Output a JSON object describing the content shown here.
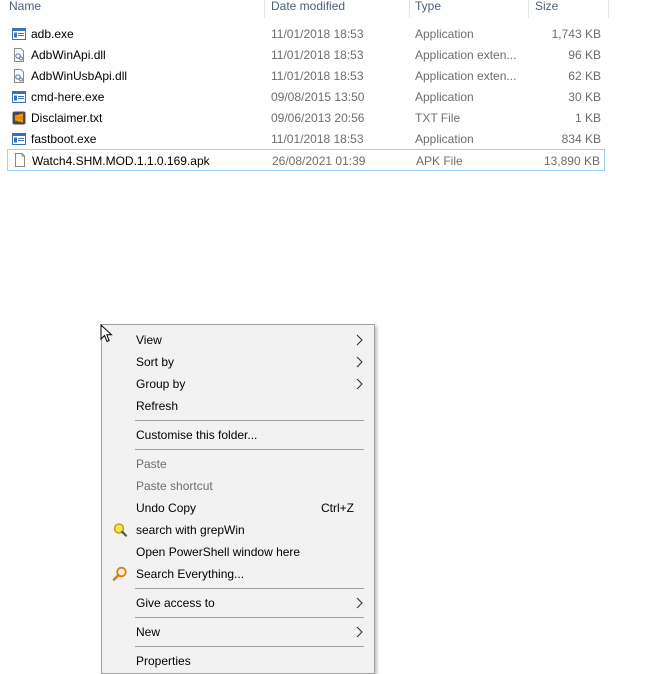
{
  "columns": {
    "name": "Name",
    "date": "Date modified",
    "type": "Type",
    "size": "Size"
  },
  "files": [
    {
      "name": "adb.exe",
      "date": "11/01/2018 18:53",
      "type": "Application",
      "size": "1,743 KB",
      "icon": "exe-icon"
    },
    {
      "name": "AdbWinApi.dll",
      "date": "11/01/2018 18:53",
      "type": "Application exten...",
      "size": "96 KB",
      "icon": "dll-icon"
    },
    {
      "name": "AdbWinUsbApi.dll",
      "date": "11/01/2018 18:53",
      "type": "Application exten...",
      "size": "62 KB",
      "icon": "dll-icon"
    },
    {
      "name": "cmd-here.exe",
      "date": "09/08/2015 13:50",
      "type": "Application",
      "size": "30 KB",
      "icon": "exe-icon"
    },
    {
      "name": "Disclaimer.txt",
      "date": "09/06/2013 20:56",
      "type": "TXT File",
      "size": "1 KB",
      "icon": "sublime-text-icon"
    },
    {
      "name": "fastboot.exe",
      "date": "11/01/2018 18:53",
      "type": "Application",
      "size": "834 KB",
      "icon": "exe-icon"
    },
    {
      "name": "Watch4.SHM.MOD.1.1.0.169.apk",
      "date": "26/08/2021 01:39",
      "type": "APK File",
      "size": "13,890 KB",
      "icon": "blank-file-icon"
    }
  ],
  "context_menu": {
    "view": "View",
    "sort_by": "Sort by",
    "group_by": "Group by",
    "refresh": "Refresh",
    "customise": "Customise this folder...",
    "paste": "Paste",
    "paste_shortcut": "Paste shortcut",
    "undo_copy": "Undo Copy",
    "undo_shortcut": "Ctrl+Z",
    "grepwin": "search with grepWin",
    "powershell": "Open PowerShell window here",
    "everything": "Search Everything...",
    "give_access": "Give access to",
    "new": "New",
    "properties": "Properties"
  },
  "colors": {
    "selection_border": "#99d1ff",
    "menu_bg": "#f2f2f2",
    "header_text": "#4c607a",
    "secondary_text": "#6d6d6d"
  }
}
